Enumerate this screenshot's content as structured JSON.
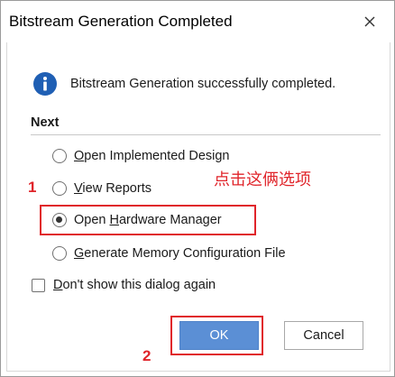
{
  "dialog": {
    "title": "Bitstream Generation Completed",
    "close_icon": "close-icon",
    "message_icon": "info-icon",
    "message": "Bitstream Generation successfully completed.",
    "section_heading": "Next",
    "options": [
      {
        "pre": "",
        "key": "O",
        "post": "pen Implemented Design",
        "selected": false
      },
      {
        "pre": "",
        "key": "V",
        "post": "iew Reports",
        "selected": false
      },
      {
        "pre": "Open ",
        "key": "H",
        "post": "ardware Manager",
        "selected": true
      },
      {
        "pre": "",
        "key": "G",
        "post": "enerate Memory Configuration File",
        "selected": false
      }
    ],
    "checkbox": {
      "pre": "",
      "key": "D",
      "post": "on't show this dialog again",
      "checked": false
    },
    "ok_label": "OK",
    "cancel_label": "Cancel"
  },
  "annotations": {
    "step1": "1",
    "step2": "2",
    "note": "点击这俩选项",
    "color": "#e0242a"
  },
  "colors": {
    "info_icon": "#1f5fb4",
    "ok_button": "#5b8fd5"
  }
}
